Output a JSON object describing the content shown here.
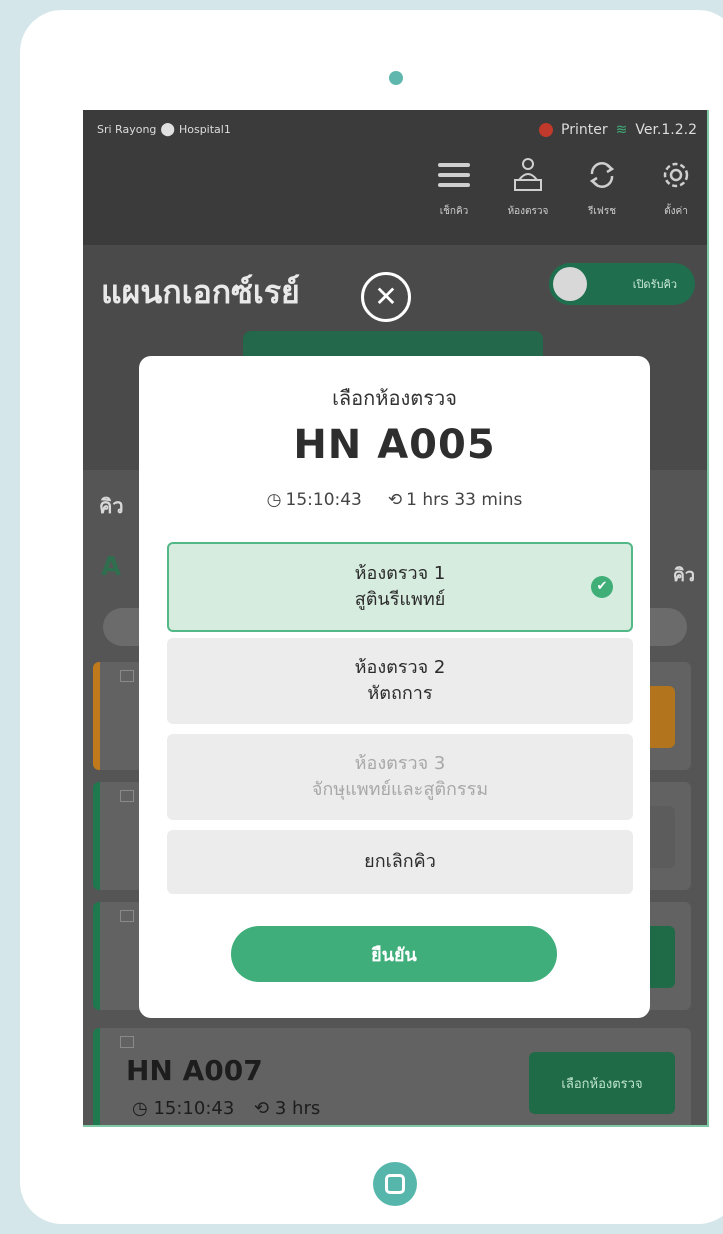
{
  "status_bar": {
    "location": "Sri Rayong",
    "hospital": "Hospital1",
    "printer_label": "Printer",
    "version": "Ver.1.2.2"
  },
  "toolbar": {
    "items": [
      {
        "label": "เช็กคิว",
        "icon": "menu-lines-icon"
      },
      {
        "label": "ห้องตรวจ",
        "icon": "doctor-desk-icon"
      },
      {
        "label": "รีเฟรช",
        "icon": "refresh-icon"
      },
      {
        "label": "ตั้งค่า",
        "icon": "gear-icon"
      }
    ]
  },
  "department": {
    "title": "แผนกเอกซ์เรย์",
    "toggle_label": "เปิดรับคิว"
  },
  "background_list": {
    "queue_label_fragment": "คิว",
    "section_letter": "A",
    "section_right_fragment": "คิว",
    "last_card": {
      "hn": "HN A007",
      "time": "15:10:43",
      "wait": "3 hrs",
      "button_label": "เลือกห้องตรวจ"
    }
  },
  "modal": {
    "title": "เลือกห้องตรวจ",
    "hn": "HN A005",
    "time": "15:10:43",
    "wait": "1 hrs 33 mins",
    "rooms": [
      {
        "name": "ห้องตรวจ 1",
        "subtitle": "สูตินรีแพทย์",
        "state": "selected"
      },
      {
        "name": "ห้องตรวจ 2",
        "subtitle": "หัตถการ",
        "state": "normal"
      },
      {
        "name": "ห้องตรวจ 3",
        "subtitle": "จักษุแพทย์และสูติกรรม",
        "state": "disabled"
      }
    ],
    "cancel_label": "ยกเลิกคิว",
    "confirm_label": "ยืนยัน"
  },
  "colors": {
    "accent": "#3fae7a",
    "frame": "#d4e6e9",
    "selected_bg": "#d6ecdf"
  }
}
